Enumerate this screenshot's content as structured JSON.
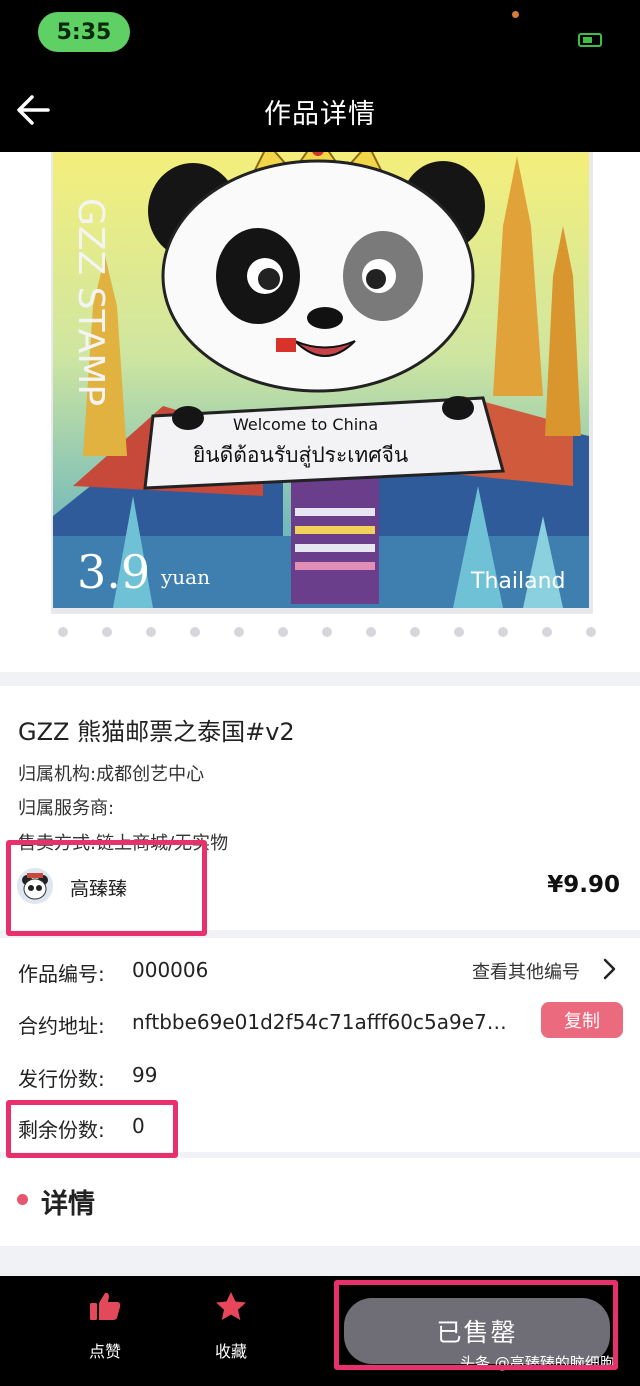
{
  "status_bar": {
    "time": "5:35"
  },
  "nav": {
    "title": "作品详情"
  },
  "stamp": {
    "brand_text": "GZZ STAMP",
    "sign_line1": "Welcome to China",
    "sign_line2": "ยินดีต้อนรับสู่ประเทศจีน",
    "value": "3.9",
    "currency": "yuan",
    "country": "Thailand"
  },
  "info": {
    "title": "GZZ 熊猫邮票之泰国#v2",
    "institution": "归属机构:成都创艺中心",
    "service_provider": "归属服务商:",
    "sale_method": "售卖方式:链上商城/无实物",
    "creator_name": "高臻臻",
    "price": "¥9.90"
  },
  "details": {
    "work_no_label": "作品编号:",
    "work_no": "000006",
    "view_other": "查看其他编号",
    "contract_label": "合约地址:",
    "contract": "nftbbe69e01d2f54c71afff60c5a9e7…",
    "copy_label": "复制",
    "issued_label": "发行份数:",
    "issued": "99",
    "remaining_label": "剩余份数:",
    "remaining": "0"
  },
  "section": {
    "title": "详情"
  },
  "bottom_bar": {
    "like_label": "点赞",
    "favorite_label": "收藏",
    "soldout_label": "已售罄",
    "watermark": "头条 @高臻臻的脑细胞"
  },
  "colors": {
    "highlight": "#e8306c",
    "copy_button": "#ec6a7d",
    "status_green": "#5fd164",
    "like_icon": "#e24a5c",
    "favorite_icon": "#e8465a"
  }
}
